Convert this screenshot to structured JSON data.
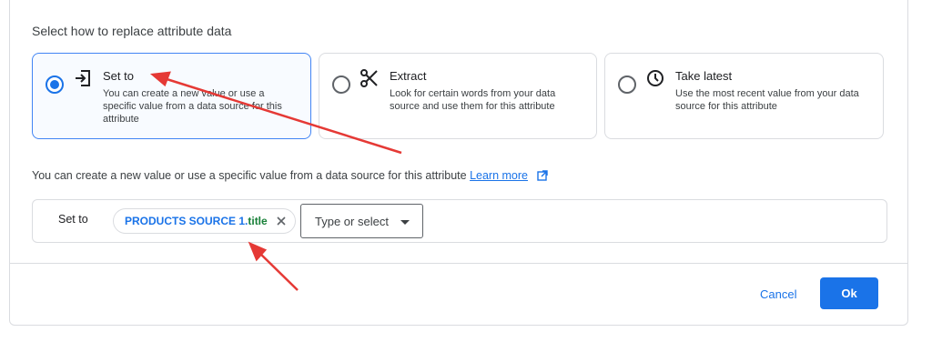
{
  "section_title": "Select how to replace attribute data",
  "options": [
    {
      "title": "Set to",
      "description": "You can create a new value or use a specific value from a data source for this attribute",
      "icon": "input-arrow-icon",
      "selected": true
    },
    {
      "title": "Extract",
      "description": "Look for certain words from your data source and use them for this attribute",
      "icon": "scissors-icon",
      "selected": false
    },
    {
      "title": "Take latest",
      "description": "Use the most recent value from your data source for this attribute",
      "icon": "clock-icon",
      "selected": false
    }
  ],
  "info": {
    "text": "You can create a new value or use a specific value from a data source for this attribute",
    "link": "Learn more",
    "link_icon": "open-in-new-icon"
  },
  "set_to": {
    "label": "Set to",
    "chip_source": "PRODUCTS SOURCE 1.",
    "chip_field": "title",
    "select_placeholder": "Type or select"
  },
  "footer": {
    "cancel_label": "Cancel",
    "ok_label": "Ok"
  },
  "colors": {
    "accent": "#1a73e8",
    "field": "#188038",
    "annotation_arrow": "#e53935"
  }
}
